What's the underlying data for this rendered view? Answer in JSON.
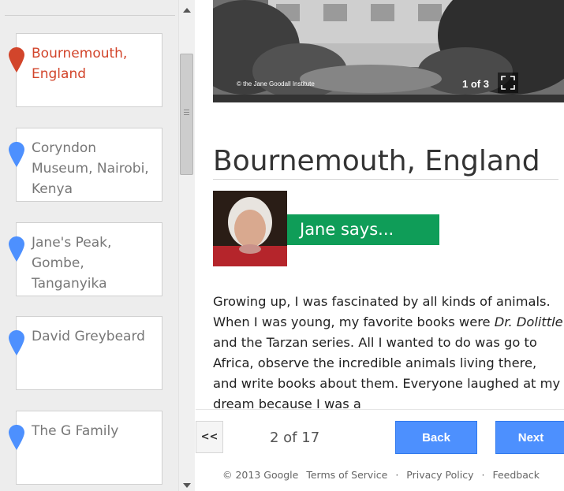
{
  "sidebar": {
    "items": [
      {
        "label": "Bournemouth, England",
        "active": true,
        "pin_color": "#d2452b"
      },
      {
        "label": "Coryndon Museum, Nairobi, Kenya",
        "active": false,
        "pin_color": "#4d90fe"
      },
      {
        "label": "Jane's Peak, Gombe, Tanganyika",
        "active": false,
        "pin_color": "#4d90fe"
      },
      {
        "label": "David Greybeard",
        "active": false,
        "pin_color": "#4d90fe"
      },
      {
        "label": "The G Family",
        "active": false,
        "pin_color": "#4d90fe"
      }
    ]
  },
  "photo": {
    "credit": "© the Jane Goodall Institute",
    "counter": "1 of 3"
  },
  "main": {
    "title": "Bournemouth, England",
    "banner": "Jane says...",
    "body_1": "Growing up, I was fascinated by all kinds of animals.  When I was young, my favorite books were ",
    "body_italic": "Dr. Dolittle",
    "body_2": " and the Tarzan series.  All I wanted to do was go to Africa, observe the incredible animals living there, and write books about them. Everyone laughed at my dream because I was a"
  },
  "pager": {
    "prev_label": "<<",
    "indicator": "2 of 17",
    "back_label": "Back",
    "next_label": "Next"
  },
  "footer": {
    "copyright": "© 2013 Google",
    "terms": "Terms of Service",
    "privacy": "Privacy Policy",
    "feedback": "Feedback",
    "separator": "·"
  },
  "colors": {
    "accent_blue": "#4d90fe",
    "active_red": "#d2452b",
    "banner_green": "#0f9d58"
  }
}
